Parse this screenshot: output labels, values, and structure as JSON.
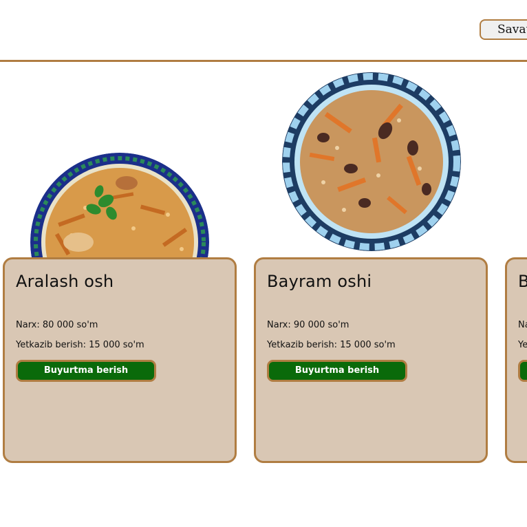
{
  "header": {
    "cart_label": "Savat"
  },
  "products": [
    {
      "name": "Aralash osh",
      "price": "Narx: 80 000 so'm",
      "delivery": "Yetkazib berish: 15 000 so'm",
      "order_label": "Buyurtma berish"
    },
    {
      "name": "Bayram oshi",
      "price": "Narx: 90 000 so'm",
      "delivery": "Yetkazib berish: 15 000 so'm",
      "order_label": "Buyurtma berish"
    },
    {
      "name": "B",
      "price": "Na",
      "delivery": "Ye",
      "order_label": ""
    }
  ],
  "colors": {
    "accent": "#b07d42",
    "card_bg": "#d9c7b4",
    "button_bg": "#0a6a0a"
  }
}
